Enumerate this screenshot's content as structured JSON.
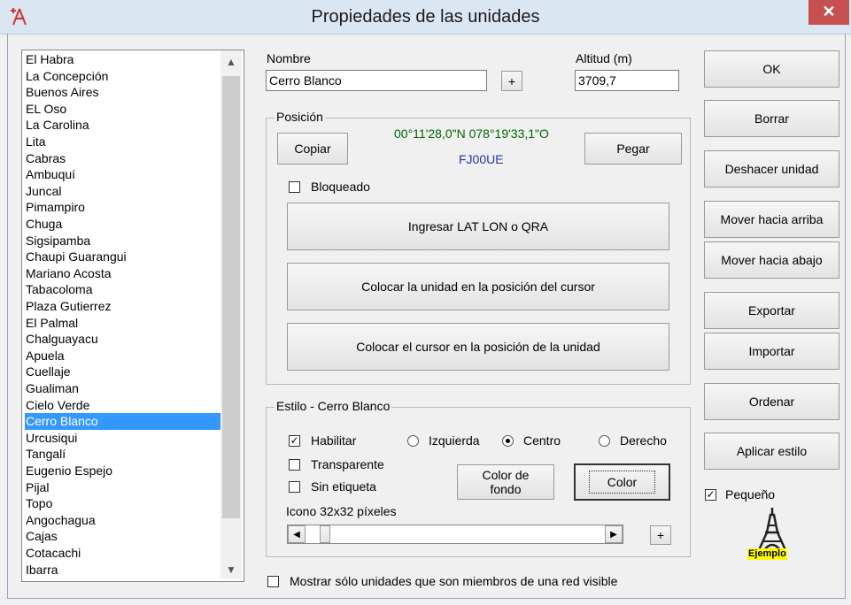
{
  "window": {
    "title": "Propiedades de las unidades",
    "close": "✕"
  },
  "units_list": {
    "items": [
      "El Habra",
      "La Concepción",
      "Buenos Aires",
      "EL Oso",
      "La Carolina",
      "Lita",
      "Cabras",
      "Ambuquí",
      "Juncal",
      "Pimampiro",
      "Chuga",
      "Sigsipamba",
      "Chaupi Guarangui",
      "Mariano Acosta",
      "Tabacoloma",
      "Plaza Gutierrez",
      "El Palmal",
      "Chalguayacu",
      "Apuela",
      "Cuellaje",
      "Gualiman",
      "Cielo Verde",
      "Cerro Blanco",
      "Urcusiqui",
      "Tangalí",
      "Eugenio Espejo",
      "Pijal",
      "Topo",
      "Angochagua",
      "Cajas",
      "Cotacachi",
      "Ibarra"
    ],
    "selected": "Cerro Blanco",
    "scroll_up": "▲",
    "scroll_down": "▼"
  },
  "name_field": {
    "label": "Nombre",
    "value": "Cerro Blanco",
    "plus": "+"
  },
  "altitude_field": {
    "label": "Altitud (m)",
    "value": "3709,7"
  },
  "position": {
    "group_label": "Posición",
    "coords": "00°11'28,0\"N 078°19'33,1\"O",
    "qra": "FJ00UE",
    "copy_label": "Copiar",
    "paste_label": "Pegar",
    "locked_label": "Bloqueado",
    "locked": false,
    "enter_latlon_label": "Ingresar LAT LON o QRA",
    "place_unit_label": "Colocar la unidad en la posición del cursor",
    "place_cursor_label": "Colocar el cursor en la posición de la unidad"
  },
  "style": {
    "group_label": "Estilo - Cerro Blanco",
    "enable_label": "Habilitar",
    "enable": true,
    "transparent_label": "Transparente",
    "transparent": false,
    "no_label_label": "Sin etiqueta",
    "no_label": false,
    "align_left_label": "Izquierda",
    "align_center_label": "Centro",
    "align_right_label": "Derecho",
    "align_selected": "Centro",
    "bg_color_label_1": "Color de",
    "bg_color_label_2": "fondo",
    "color_label": "Color",
    "icon_size_label": "Icono 32x32 píxeles",
    "icon_size_value": 0,
    "scroll_left": "◀",
    "scroll_right": "▶",
    "plus": "+"
  },
  "footer": {
    "show_members_label": "Mostrar sólo unidades que son miembros de una red visible",
    "show_members": false
  },
  "right_buttons": {
    "ok": "OK",
    "delete": "Borrar",
    "undo": "Deshacer unidad",
    "move_up": "Mover hacia arriba",
    "move_down": "Mover hacia abajo",
    "export": "Exportar",
    "import": "Importar",
    "sort": "Ordenar",
    "apply_style": "Aplicar estilo"
  },
  "small": {
    "label": "Pequeño",
    "checked": true,
    "example_label": "Ejemplo"
  },
  "colors": {
    "selection": "#3399ff",
    "coords": "#006400",
    "qra": "#2233aa",
    "close": "#c75050",
    "example_bg": "#ffff00"
  }
}
